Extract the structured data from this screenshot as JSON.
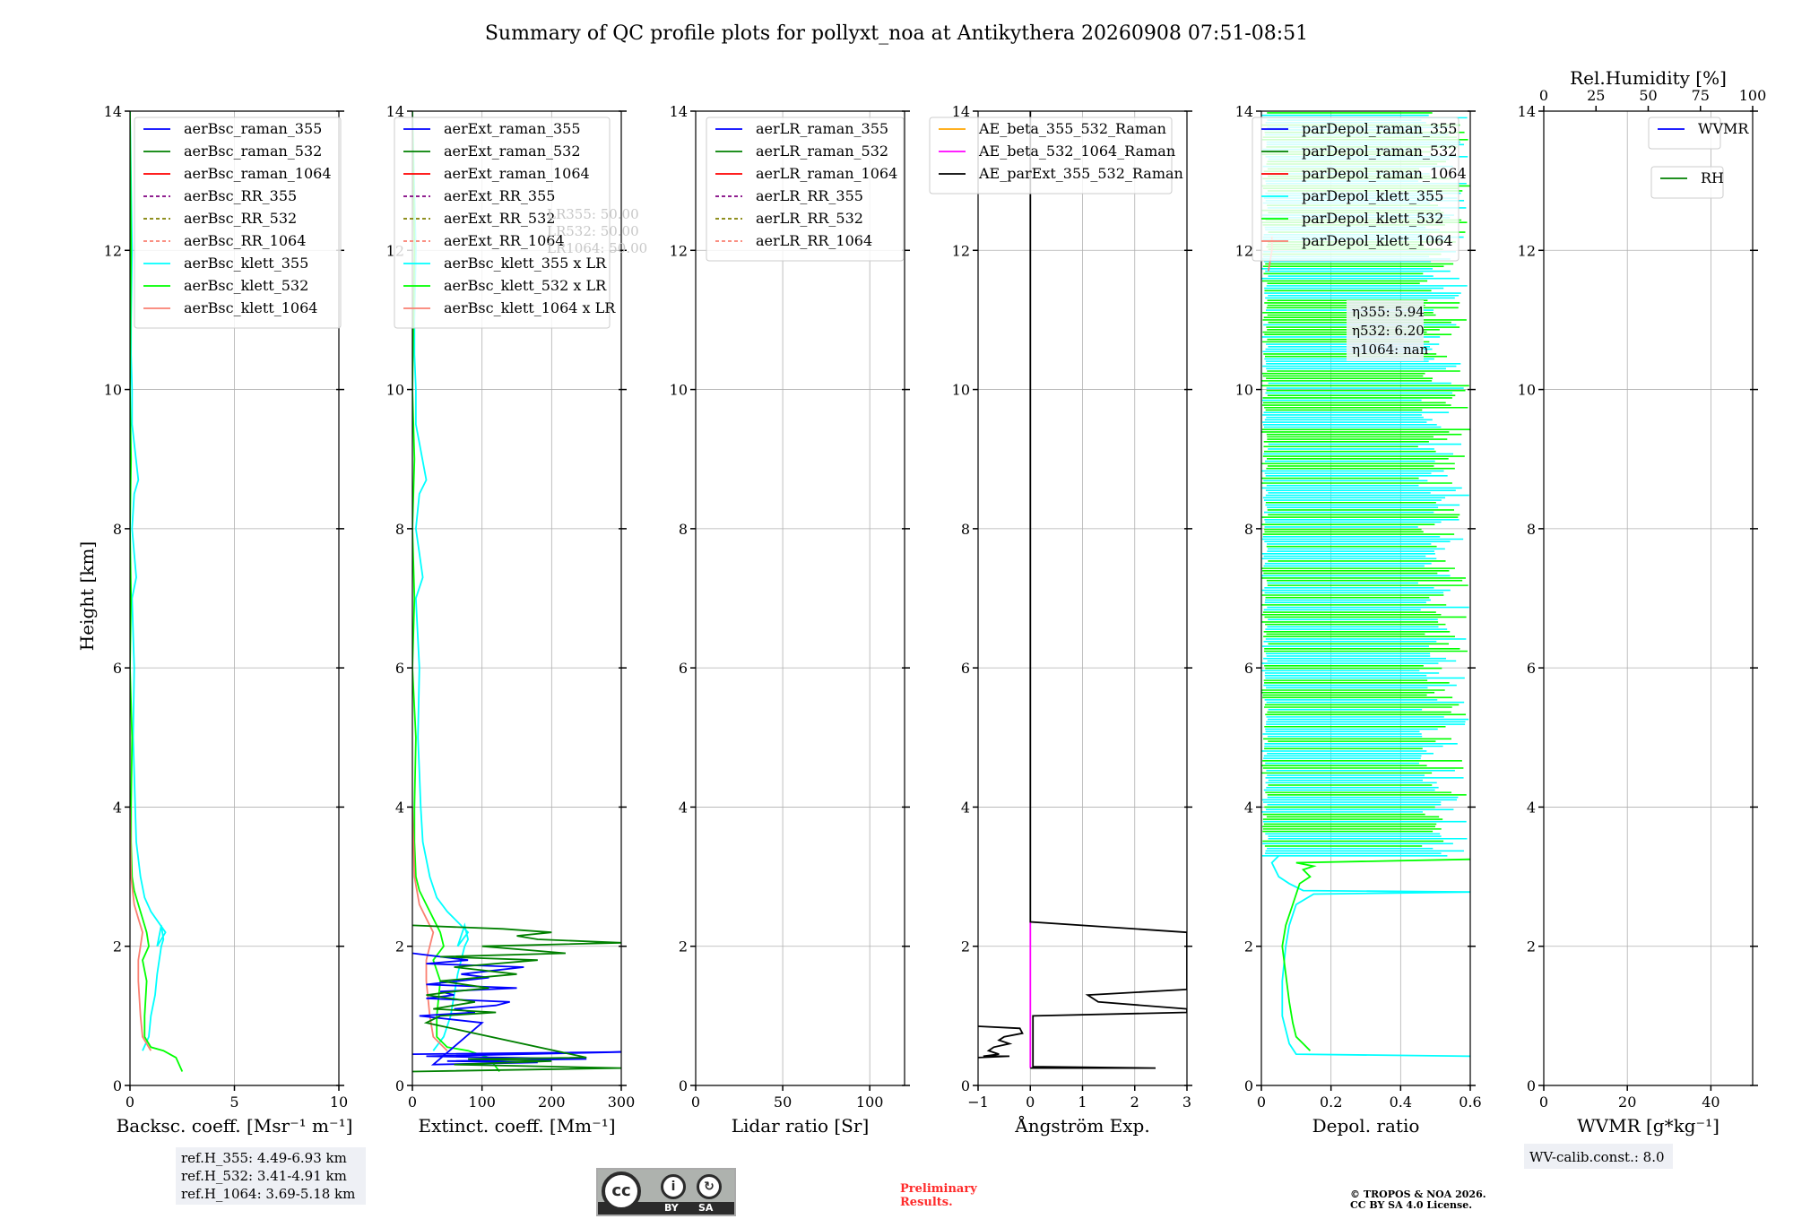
{
  "title": "Summary of QC profile plots for pollyxt_noa at Antikythera 20260908 07:51-08:51",
  "height_label": "Height [km]",
  "ref_box": [
    "ref.H_355: 4.49-6.93 km",
    "ref.H_532: 3.41-4.91 km",
    "ref.H_1064: 3.69-5.18 km"
  ],
  "wv_calib": "WV-calib.const.: 8.0",
  "preliminary": [
    "Preliminary",
    "Results."
  ],
  "copyright": [
    "© TROPOS & NOA 2026.",
    "CC BY SA 4.0 License."
  ],
  "cc_logo": {
    "cc": "cc",
    "by": "BY",
    "sa": "SA",
    "by_icon": "i",
    "sa_icon": "↻"
  },
  "eta_box": [
    "η355: 5.94",
    "η532: 6.20",
    "η1064: nan"
  ],
  "lr_box_faint": [
    "LR355: 50.00",
    "LR532: 50.00",
    "LR1064: 50.00"
  ],
  "colors": {
    "blue": "#0000ff",
    "green": "#008000",
    "red": "#ff0000",
    "purple": "#800080",
    "olive": "#808000",
    "salmon": "#fa8072",
    "cyan": "#00ffff",
    "lime": "#00ff00",
    "orange": "#ffa500",
    "magenta": "#ff00ff",
    "black": "#000000"
  },
  "chart_data": [
    {
      "type": "line",
      "id": "bsc",
      "xlabel": "Backsc. coeff. [Msr⁻¹ m⁻¹]",
      "xlim": [
        0,
        10
      ],
      "xticks": [
        0,
        5,
        10
      ],
      "ylim": [
        0,
        14
      ],
      "yticks": [
        0,
        2,
        4,
        6,
        8,
        10,
        12,
        14
      ],
      "legend": [
        {
          "name": "aerBsc_raman_355",
          "color": "blue",
          "dash": false
        },
        {
          "name": "aerBsc_raman_532",
          "color": "green",
          "dash": false
        },
        {
          "name": "aerBsc_raman_1064",
          "color": "red",
          "dash": false
        },
        {
          "name": "aerBsc_RR_355",
          "color": "purple",
          "dash": true
        },
        {
          "name": "aerBsc_RR_532",
          "color": "olive",
          "dash": true
        },
        {
          "name": "aerBsc_RR_1064",
          "color": "salmon",
          "dash": true
        },
        {
          "name": "aerBsc_klett_355",
          "color": "cyan",
          "dash": false
        },
        {
          "name": "aerBsc_klett_532",
          "color": "lime",
          "dash": false
        },
        {
          "name": "aerBsc_klett_1064",
          "color": "salmon",
          "dash": false
        }
      ],
      "series": [
        {
          "color": "cyan",
          "x": [
            0.6,
            0.9,
            1.0,
            1.2,
            1.3,
            1.4,
            1.5,
            1.6,
            1.5,
            1.3,
            1.7,
            1.0,
            0.7,
            0.5,
            0.3,
            0.25,
            0.2,
            0.15,
            0.2,
            0.1,
            0.3,
            0.1,
            0.2,
            0.4,
            0.1,
            0.1,
            0.05,
            0.05,
            0.1,
            0.0
          ],
          "y": [
            0.5,
            0.7,
            1.0,
            1.3,
            1.6,
            1.8,
            2.0,
            2.1,
            2.3,
            2.0,
            2.2,
            2.5,
            2.7,
            3.0,
            3.5,
            4.0,
            4.5,
            5.0,
            6.0,
            7.0,
            7.3,
            8.0,
            8.5,
            8.7,
            9.5,
            10.0,
            10.5,
            11.0,
            12.0,
            14.0
          ]
        },
        {
          "color": "lime",
          "x": [
            2.5,
            2.2,
            1.6,
            1.0,
            0.7,
            0.7,
            0.8,
            0.6,
            0.9,
            0.8,
            0.6,
            0.4,
            0.2,
            0.1,
            0.05,
            0.05,
            0.1,
            0.0,
            0.05,
            0.0,
            0.05,
            0.0,
            0.05,
            0.0
          ],
          "y": [
            0.2,
            0.4,
            0.5,
            0.55,
            0.7,
            1.0,
            1.5,
            1.8,
            2.0,
            2.2,
            2.4,
            2.6,
            2.8,
            3.0,
            3.5,
            4.0,
            5.0,
            6.0,
            7.0,
            8.0,
            9.0,
            10.0,
            12.0,
            14.0
          ]
        },
        {
          "color": "salmon",
          "x": [
            1.0,
            0.6,
            0.5,
            0.4,
            0.4,
            0.5,
            0.6,
            0.4,
            0.2,
            0.05,
            0.0
          ],
          "y": [
            0.5,
            0.7,
            1.0,
            1.5,
            1.8,
            2.0,
            2.2,
            2.4,
            2.6,
            3.0,
            4.0
          ]
        }
      ]
    },
    {
      "type": "line",
      "id": "ext",
      "xlabel": "Extinct. coeff. [Mm⁻¹]",
      "xlim": [
        0,
        300
      ],
      "xticks": [
        0,
        100,
        200,
        300
      ],
      "ylim": [
        0,
        14
      ],
      "yticks": [
        0,
        2,
        4,
        6,
        8,
        10,
        12,
        14
      ],
      "legend": [
        {
          "name": "aerExt_raman_355",
          "color": "blue",
          "dash": false
        },
        {
          "name": "aerExt_raman_532",
          "color": "green",
          "dash": false
        },
        {
          "name": "aerExt_raman_1064",
          "color": "red",
          "dash": false
        },
        {
          "name": "aerExt_RR_355",
          "color": "purple",
          "dash": true
        },
        {
          "name": "aerExt_RR_532",
          "color": "olive",
          "dash": true
        },
        {
          "name": "aerExt_RR_1064",
          "color": "salmon",
          "dash": true
        },
        {
          "name": "aerBsc_klett_355 x LR",
          "color": "cyan",
          "dash": false
        },
        {
          "name": "aerBsc_klett_532 x LR",
          "color": "lime",
          "dash": false
        },
        {
          "name": "aerBsc_klett_1064 x LR",
          "color": "salmon",
          "dash": false
        }
      ],
      "series": [
        {
          "color": "cyan",
          "x": [
            30,
            45,
            55,
            60,
            65,
            70,
            75,
            80,
            75,
            65,
            80,
            50,
            35,
            25,
            15,
            12,
            10,
            8,
            10,
            5,
            15,
            5,
            10,
            20,
            5,
            5,
            3,
            3,
            5,
            0
          ],
          "y": [
            0.5,
            0.7,
            1.0,
            1.3,
            1.6,
            1.8,
            2.0,
            2.1,
            2.3,
            2.0,
            2.2,
            2.5,
            2.7,
            3.0,
            3.5,
            4.0,
            4.5,
            5.0,
            6.0,
            7.0,
            7.3,
            8.0,
            8.5,
            8.7,
            9.5,
            10.0,
            10.5,
            11.0,
            12.0,
            14.0
          ]
        },
        {
          "color": "lime",
          "x": [
            125,
            110,
            80,
            50,
            35,
            35,
            40,
            30,
            45,
            40,
            30,
            20,
            10,
            5,
            3,
            3,
            5,
            0,
            3,
            0,
            3,
            0,
            3,
            0
          ],
          "y": [
            0.2,
            0.4,
            0.5,
            0.55,
            0.7,
            1.0,
            1.5,
            1.8,
            2.0,
            2.2,
            2.4,
            2.6,
            2.8,
            3.0,
            3.5,
            4.0,
            5.0,
            6.0,
            7.0,
            8.0,
            9.0,
            10.0,
            12.0,
            14.0
          ]
        },
        {
          "color": "salmon",
          "x": [
            50,
            30,
            25,
            20,
            20,
            25,
            30,
            20,
            10,
            3,
            0
          ],
          "y": [
            0.5,
            0.7,
            1.0,
            1.5,
            1.8,
            2.0,
            2.2,
            2.4,
            2.6,
            3.0,
            4.0
          ]
        },
        {
          "color": "blue",
          "x": [
            0,
            300,
            20,
            250,
            50,
            180,
            30,
            100,
            10,
            90,
            60,
            120,
            140,
            20,
            60,
            40,
            150,
            20,
            110,
            70,
            160,
            20,
            80,
            0
          ],
          "y": [
            0.45,
            0.48,
            0.42,
            0.38,
            0.35,
            0.33,
            0.3,
            0.9,
            1.0,
            1.05,
            1.1,
            1.15,
            1.2,
            1.25,
            1.3,
            1.35,
            1.4,
            1.45,
            1.55,
            1.6,
            1.7,
            1.75,
            1.8,
            1.9
          ]
        },
        {
          "color": "green",
          "x": [
            0,
            300,
            60,
            200,
            80,
            250,
            20,
            40,
            120,
            30,
            90,
            20,
            60,
            110,
            40,
            150,
            60,
            180,
            40,
            220,
            100,
            300,
            180,
            150,
            200,
            130,
            0
          ],
          "y": [
            0.2,
            0.25,
            0.3,
            0.35,
            0.38,
            0.4,
            0.9,
            1.0,
            1.05,
            1.1,
            1.2,
            1.3,
            1.35,
            1.4,
            1.5,
            1.6,
            1.7,
            1.8,
            1.85,
            1.9,
            2.0,
            2.05,
            2.1,
            2.15,
            2.2,
            2.25,
            2.3
          ]
        }
      ]
    },
    {
      "type": "line",
      "id": "lr",
      "xlabel": "Lidar ratio [Sr]",
      "xlim": [
        0,
        120
      ],
      "xticks": [
        0,
        50,
        100
      ],
      "ylim": [
        0,
        14
      ],
      "yticks": [
        0,
        2,
        4,
        6,
        8,
        10,
        12,
        14
      ],
      "legend": [
        {
          "name": "aerLR_raman_355",
          "color": "blue",
          "dash": false
        },
        {
          "name": "aerLR_raman_532",
          "color": "green",
          "dash": false
        },
        {
          "name": "aerLR_raman_1064",
          "color": "red",
          "dash": false
        },
        {
          "name": "aerLR_RR_355",
          "color": "purple",
          "dash": true
        },
        {
          "name": "aerLR_RR_532",
          "color": "olive",
          "dash": true
        },
        {
          "name": "aerLR_RR_1064",
          "color": "salmon",
          "dash": true
        }
      ],
      "series": []
    },
    {
      "type": "line",
      "id": "ae",
      "xlabel": "Ångström Exp.",
      "xlim": [
        -1,
        3
      ],
      "xticks": [
        -1,
        0,
        1,
        2,
        3
      ],
      "ylim": [
        0,
        14
      ],
      "yticks": [
        0,
        2,
        4,
        6,
        8,
        10,
        12,
        14
      ],
      "legend": [
        {
          "name": "AE_beta_355_532_Raman",
          "color": "orange",
          "dash": false
        },
        {
          "name": "AE_beta_532_1064_Raman",
          "color": "magenta",
          "dash": false
        },
        {
          "name": "AE_parExt_355_532_Raman",
          "color": "black",
          "dash": false
        }
      ],
      "series": [
        {
          "color": "magenta",
          "x": [
            0,
            0
          ],
          "y": [
            0.25,
            2.35
          ]
        },
        {
          "color": "black",
          "x": [
            0,
            0,
            3.0,
            3.0,
            1.1,
            1.3,
            3.0,
            3.0,
            0.05,
            0.05,
            2.4,
            2.4,
            0.0
          ],
          "y": [
            14,
            2.35,
            2.2,
            1.38,
            1.3,
            1.2,
            1.1,
            1.05,
            1.0,
            0.27,
            0.25,
            0.25,
            0.25
          ]
        },
        {
          "color": "black",
          "x": [
            -1.0,
            -0.2,
            -0.15,
            -0.5,
            -0.6,
            -0.4,
            -0.7,
            -0.8,
            -0.6,
            -0.9,
            -0.4,
            -1.0
          ],
          "y": [
            0.85,
            0.82,
            0.75,
            0.7,
            0.65,
            0.6,
            0.55,
            0.5,
            0.45,
            0.42,
            0.42,
            0.4
          ]
        }
      ]
    },
    {
      "type": "line",
      "id": "depol",
      "xlabel": "Depol. ratio",
      "xlim": [
        0.0,
        0.6
      ],
      "xticks": [
        0.0,
        0.2,
        0.4,
        0.6
      ],
      "ylim": [
        0,
        14
      ],
      "yticks": [
        0,
        2,
        4,
        6,
        8,
        10,
        12,
        14
      ],
      "legend": [
        {
          "name": "parDepol_raman_355",
          "color": "blue",
          "dash": false
        },
        {
          "name": "parDepol_raman_532",
          "color": "green",
          "dash": false
        },
        {
          "name": "parDepol_raman_1064",
          "color": "red",
          "dash": false
        },
        {
          "name": "parDepol_klett_355",
          "color": "cyan",
          "dash": false
        },
        {
          "name": "parDepol_klett_532",
          "color": "lime",
          "dash": false
        },
        {
          "name": "parDepol_klett_1064",
          "color": "salmon",
          "dash": false
        }
      ],
      "series": [
        {
          "color": "cyan",
          "x": [
            0.6,
            0.1,
            0.08,
            0.07,
            0.06,
            0.06,
            0.07,
            0.08,
            0.1,
            0.15,
            0.6,
            0.12,
            0.08,
            0.05,
            0.04,
            0.03,
            0.05
          ],
          "y": [
            0.42,
            0.45,
            0.6,
            0.8,
            1.0,
            1.5,
            2.0,
            2.3,
            2.6,
            2.75,
            2.78,
            2.8,
            2.9,
            3.0,
            3.1,
            3.2,
            3.3
          ]
        },
        {
          "color": "lime",
          "x": [
            0.14,
            0.12,
            0.1,
            0.09,
            0.08,
            0.07,
            0.06,
            0.07,
            0.09,
            0.11,
            0.14,
            0.12,
            0.15,
            0.1,
            0.6
          ],
          "y": [
            0.5,
            0.6,
            0.7,
            0.9,
            1.2,
            1.6,
            2.0,
            2.3,
            2.6,
            2.9,
            3.0,
            3.1,
            3.15,
            3.2,
            3.25
          ]
        },
        {
          "color": "salmon",
          "x": [
            0.02,
            0.03,
            0.03
          ],
          "y": [
            11.7,
            12.0,
            12.2
          ]
        }
      ]
    },
    {
      "type": "line",
      "id": "wv",
      "xlabel": "WVMR [g*kg⁻¹]",
      "xlim": [
        0,
        50
      ],
      "xticks": [
        0,
        20,
        40
      ],
      "x2label": "Rel.Humidity [%]",
      "x2lim": [
        0,
        100
      ],
      "x2ticks": [
        0,
        25,
        50,
        75,
        100
      ],
      "ylim": [
        0,
        14
      ],
      "yticks": [
        0,
        2,
        4,
        6,
        8,
        10,
        12,
        14
      ],
      "legend": [
        {
          "name": "WVMR",
          "color": "blue",
          "dash": false
        }
      ],
      "legend2": [
        {
          "name": "RH",
          "color": "green",
          "dash": false
        }
      ],
      "series": []
    }
  ]
}
